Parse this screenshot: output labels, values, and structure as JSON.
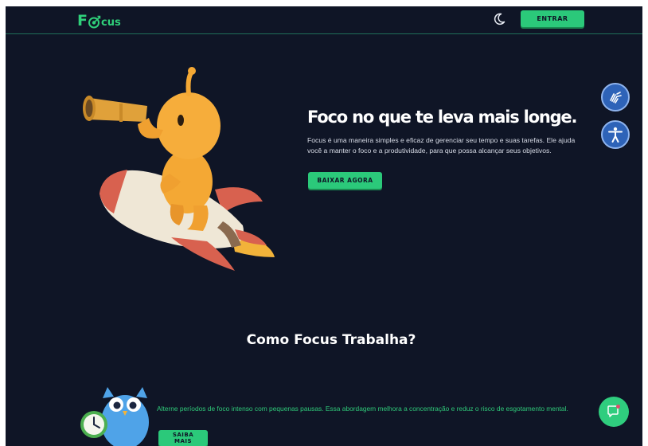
{
  "header": {
    "logo_prefix": "F",
    "logo_suffix": "cus",
    "login_label": "ENTRAR"
  },
  "hero": {
    "title": "Foco no que te leva mais longe.",
    "description": "Focus é uma maneira simples e eficaz de gerenciar seu tempo e suas tarefas. Ele ajuda você a manter o foco e a produtividade, para que possa alcançar seus objetivos.",
    "download_label": "BAIXAR AGORA"
  },
  "how_it_works": {
    "title": "Como Focus Trabalha?",
    "pomodoro_text": "Alterne períodos de foco intenso com pequenas pausas. Essa abordagem melhora a concentração e reduz o risco de esgotamento mental.",
    "learn_more_label": "SAIBA MAIS"
  },
  "icons": {
    "theme_toggle": "moon-icon",
    "sign_language": "hands-icon",
    "accessibility": "accessibility-icon",
    "chat": "chat-icon"
  },
  "colors": {
    "background": "#0f1526",
    "accent": "#2bc97a",
    "accessibility_blue": "#2e63b8"
  }
}
